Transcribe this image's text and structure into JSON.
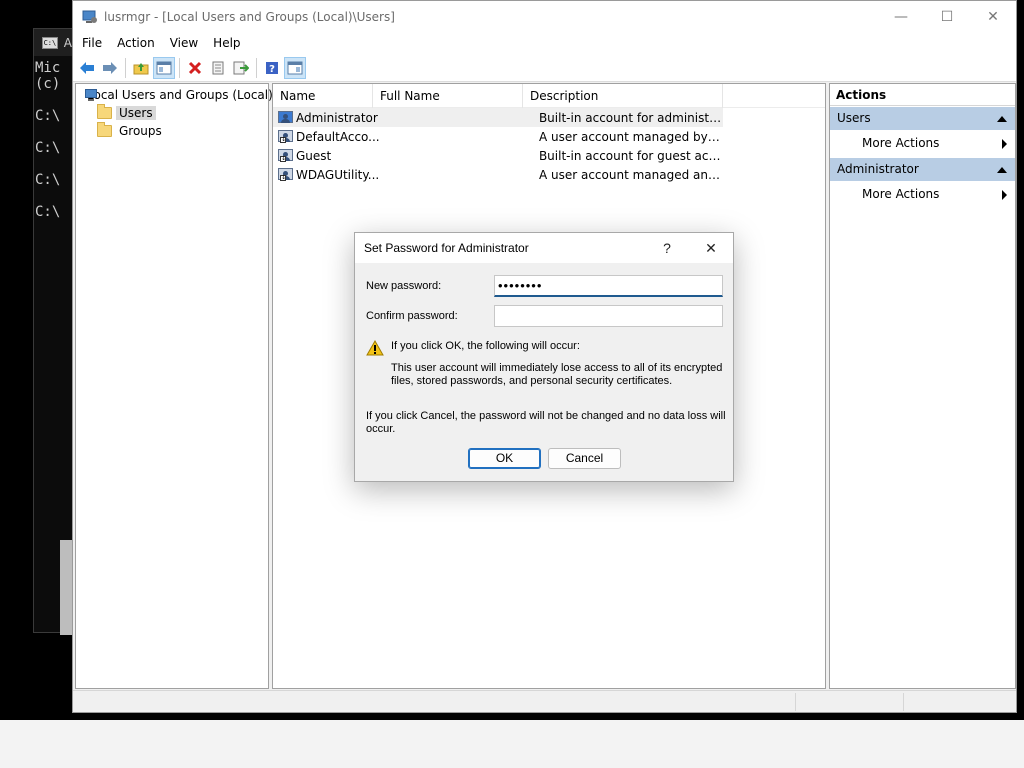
{
  "cmd": {
    "title": "A",
    "icon_text": "C:\\",
    "lines": [
      "Mic",
      "(c)",
      "",
      "C:\\",
      "",
      "C:\\",
      "",
      "C:\\",
      "",
      "C:\\"
    ]
  },
  "window": {
    "title": "lusrmgr - [Local Users and Groups (Local)\\Users]",
    "controls": {
      "minimize": "—",
      "maximize": "☐",
      "close": "✕"
    }
  },
  "menu": [
    "File",
    "Action",
    "View",
    "Help"
  ],
  "toolbar": [
    "back-icon",
    "forward-icon",
    "up-folder-icon",
    "show-hide-tree-icon",
    "delete-icon",
    "properties-icon",
    "export-list-icon",
    "help-icon",
    "show-hide-action-pane-icon"
  ],
  "tree": {
    "root": "Local Users and Groups (Local)",
    "items": [
      "Users",
      "Groups"
    ]
  },
  "list": {
    "columns": [
      "Name",
      "Full Name",
      "Description"
    ],
    "rows": [
      {
        "name": "Administrator",
        "full_name": "",
        "description": "Built-in account for administering..."
      },
      {
        "name": "DefaultAcco...",
        "full_name": "",
        "description": "A user account managed by the s..."
      },
      {
        "name": "Guest",
        "full_name": "",
        "description": "Built-in account for guest access t..."
      },
      {
        "name": "WDAGUtility...",
        "full_name": "",
        "description": "A user account managed and use..."
      }
    ]
  },
  "actions": {
    "header": "Actions",
    "sections": [
      {
        "title": "Users",
        "items": [
          "More Actions"
        ]
      },
      {
        "title": "Administrator",
        "items": [
          "More Actions"
        ]
      }
    ]
  },
  "dialog": {
    "title": "Set Password for Administrator",
    "help": "?",
    "close": "✕",
    "new_password_label": "New password:",
    "new_password_value": "••••••••",
    "confirm_password_label": "Confirm password:",
    "confirm_password_value": "",
    "warning_heading": "If you click OK, the following will occur:",
    "warning_line1": "This user account will immediately lose access to all of its encrypted",
    "warning_line2": "files, stored passwords, and personal security certificates.",
    "cancel_note_line1": "If you click Cancel, the password will not be changed and no data loss will",
    "cancel_note_line2": "occur.",
    "ok_label": "OK",
    "cancel_label": "Cancel"
  },
  "colors": {
    "selection": "#cce4f7",
    "action_section": "#b8cde4",
    "accent": "#2170c0"
  }
}
